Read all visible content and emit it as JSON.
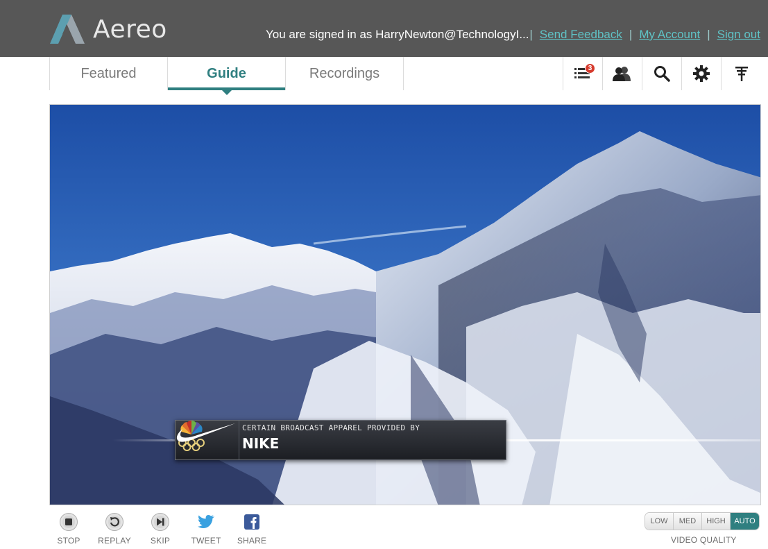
{
  "header": {
    "brand": "Aereo",
    "signin_text": "You are signed in as HarryNewton@TechnologyI...",
    "links": [
      "Send Feedback",
      "My Account",
      "Sign out"
    ],
    "separator": "|"
  },
  "nav": {
    "tabs": [
      {
        "label": "Featured",
        "active": false
      },
      {
        "label": "Guide",
        "active": true
      },
      {
        "label": "Recordings",
        "active": false
      }
    ],
    "icons": [
      {
        "name": "queue-list-icon",
        "badge": "3"
      },
      {
        "name": "people-icon"
      },
      {
        "name": "search-icon"
      },
      {
        "name": "gear-icon"
      },
      {
        "name": "antenna-icon"
      }
    ]
  },
  "video": {
    "overlay_subtitle": "CERTAIN BROADCAST APPAREL PROVIDED BY",
    "overlay_title": "NIKE"
  },
  "controls": [
    {
      "label": "STOP",
      "icon": "stop-icon"
    },
    {
      "label": "REPLAY",
      "icon": "replay-icon"
    },
    {
      "label": "SKIP",
      "icon": "skip-icon"
    },
    {
      "label": "TWEET",
      "icon": "twitter-icon"
    },
    {
      "label": "SHARE",
      "icon": "facebook-icon"
    }
  ],
  "quality": {
    "options": [
      "LOW",
      "MED",
      "HIGH",
      "AUTO"
    ],
    "selected": "AUTO",
    "label": "VIDEO QUALITY"
  },
  "colors": {
    "header_bg": "#575757",
    "accent": "#2f7f80",
    "link": "#5fc3c6",
    "badge": "#d63a2d"
  }
}
